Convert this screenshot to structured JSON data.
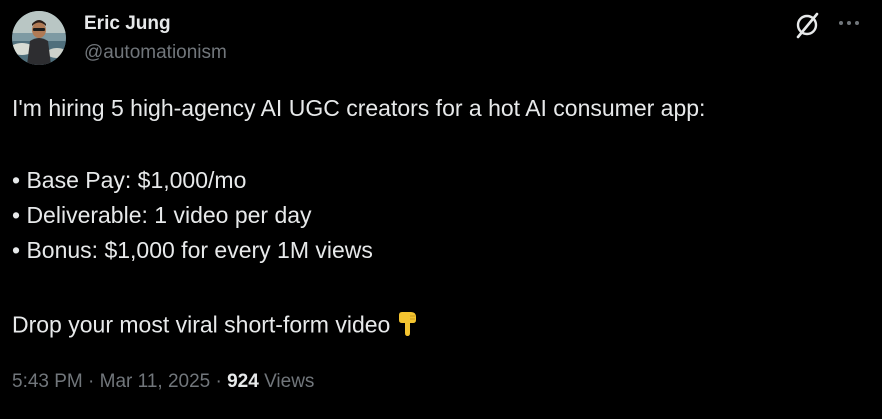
{
  "author": {
    "display_name": "Eric Jung",
    "handle": "@automationism"
  },
  "icons": {
    "grok": "grok-icon",
    "more": "more-icon",
    "emoji": "backhand-index-pointing-down"
  },
  "tweet": {
    "intro": "I'm hiring 5 high-agency AI UGC creators for a hot AI consumer app:",
    "bullets": [
      "• Base Pay: $1,000/mo",
      "• Deliverable: 1 video per day",
      "• Bonus: $1,000 for every 1M views"
    ],
    "closing": "Drop your most viral short-form video"
  },
  "meta": {
    "time": "5:43 PM",
    "separator": "·",
    "date": "Mar 11, 2025",
    "views_count": "924",
    "views_label": "Views"
  },
  "colors": {
    "background": "#000000",
    "primary_text": "#e7e9ea",
    "secondary_text": "#71767b",
    "emoji": "#f4c430"
  }
}
